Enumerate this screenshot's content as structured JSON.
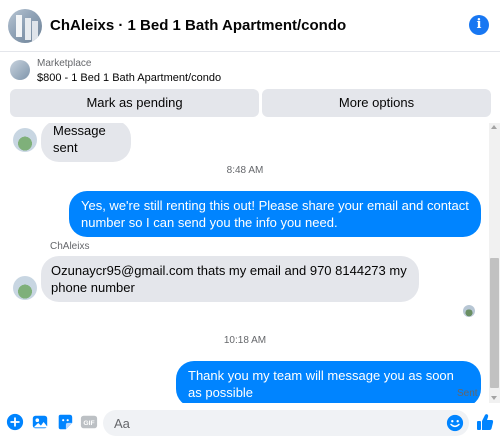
{
  "header": {
    "title": "ChAleixs · 1 Bed 1 Bath Apartment/condo",
    "info_icon": "info-icon"
  },
  "listing": {
    "label": "Marketplace",
    "value": "$800 - 1 Bed 1 Bath Apartment/condo"
  },
  "actions": {
    "mark_pending": "Mark as pending",
    "more_options": "More options"
  },
  "messages": [
    {
      "type": "incoming",
      "text": "Message sent"
    },
    {
      "type": "timestamp",
      "text": "8:48 AM"
    },
    {
      "type": "outgoing",
      "text": "Yes, we're still renting this out! Please share your email and contact number so I can send you the info you need."
    },
    {
      "type": "sender",
      "text": "ChAleixs"
    },
    {
      "type": "incoming",
      "text": "Ozunaycr95@gmail.com thats my email and 970 8144273 my phone number"
    },
    {
      "type": "timestamp",
      "text": "10:18 AM"
    },
    {
      "type": "outgoing",
      "text": "Thank you my team will message you as soon as possible"
    },
    {
      "type": "status",
      "text": "Sent"
    }
  ],
  "composer": {
    "placeholder": "Aa",
    "icons": [
      "plus-icon",
      "photo-icon",
      "sticker-icon",
      "gif-icon",
      "emoji-icon",
      "like-icon"
    ]
  },
  "colors": {
    "accent": "#0084ff",
    "brand": "#1877f2",
    "bubble_in": "#e4e6eb"
  }
}
